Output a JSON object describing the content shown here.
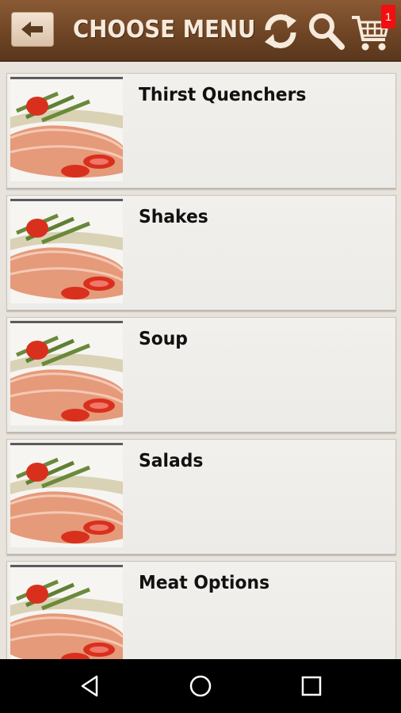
{
  "header": {
    "title": "CHOOSE MENU",
    "back_icon": "back-arrow-icon",
    "refresh_icon": "refresh-icon",
    "search_icon": "search-icon",
    "cart_icon": "cart-icon",
    "cart_badge": "1",
    "colors": {
      "bar": "#6f4525",
      "title": "#f6eadc",
      "badge": "#f20f0f"
    }
  },
  "menu": {
    "items": [
      {
        "label": "Thirst Quenchers"
      },
      {
        "label": "Shakes"
      },
      {
        "label": "Soup"
      },
      {
        "label": "Salads"
      },
      {
        "label": "Meat Options"
      }
    ]
  },
  "navbar": {
    "back_icon": "nav-back-icon",
    "home_icon": "nav-home-icon",
    "recents_icon": "nav-recents-icon"
  }
}
